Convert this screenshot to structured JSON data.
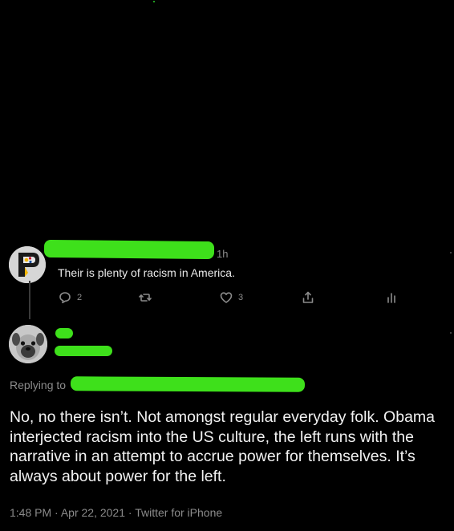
{
  "parent_tweet": {
    "time": "1h",
    "text": "Their is plenty of racism in America.",
    "reply_count": "2",
    "like_count": "3",
    "icons": {
      "reply": "comment-icon",
      "retweet": "retweet-icon",
      "like": "heart-icon",
      "share": "share-icon",
      "analytics": "analytics-icon"
    }
  },
  "reply_tweet": {
    "replying_label": "Replying to",
    "text": "No, no there isn’t. Not amongst regular everyday folk. Obama interjected racism into the US culture, the left runs with the narrative in an attempt to accrue power for themselves. It’s always about power for the left.",
    "time": "1:48 PM",
    "date": "Apr 22, 2021",
    "source": "Twitter for iPhone",
    "separator": "·"
  },
  "colors": {
    "background": "#000000",
    "redaction": "#3ee01b",
    "muted": "#8b8b8b"
  }
}
